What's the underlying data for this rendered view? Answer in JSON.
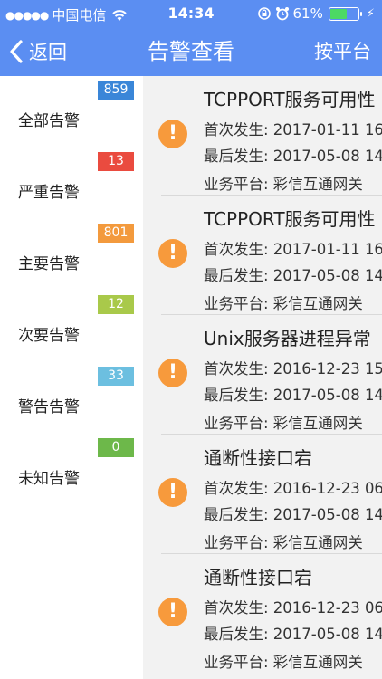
{
  "status_bar": {
    "carrier": "中国电信",
    "time": "14:34",
    "battery_percent": "61%",
    "battery_level": 0.61,
    "battery_color": "#4cd964"
  },
  "nav": {
    "back_label": "返回",
    "title": "告警查看",
    "right_label": "按平台",
    "bar_color": "#5b8ef2"
  },
  "categories": [
    {
      "label": "全部告警",
      "count": "859",
      "color": "#3a86d8"
    },
    {
      "label": "严重告警",
      "count": "13",
      "color": "#ea4b3f"
    },
    {
      "label": "主要告警",
      "count": "801",
      "color": "#f39a3d"
    },
    {
      "label": "次要告警",
      "count": "12",
      "color": "#a9c94a"
    },
    {
      "label": "警告告警",
      "count": "33",
      "color": "#6cbfe0"
    },
    {
      "label": "未知告警",
      "count": "0",
      "color": "#6db84a"
    }
  ],
  "alarms": [
    {
      "title": "TCPPORT服务可用性",
      "first": "首次发生: 2017-01-11 16:",
      "last": "最后发生: 2017-05-08 14:",
      "platform": "业务平台: 彩信互通网关",
      "icon": "exclamation-icon"
    },
    {
      "title": "TCPPORT服务可用性",
      "first": "首次发生: 2017-01-11 16:",
      "last": "最后发生: 2017-05-08 14:",
      "platform": "业务平台: 彩信互通网关",
      "icon": "exclamation-icon"
    },
    {
      "title": "Unix服务器进程异常",
      "first": "首次发生: 2016-12-23 15:",
      "last": "最后发生: 2017-05-08 14:",
      "platform": "业务平台: 彩信互通网关",
      "icon": "exclamation-icon"
    },
    {
      "title": "通断性接口宕",
      "first": "首次发生: 2016-12-23 06:",
      "last": "最后发生: 2017-05-08 14:",
      "platform": "业务平台: 彩信互通网关",
      "icon": "exclamation-icon"
    },
    {
      "title": "通断性接口宕",
      "first": "首次发生: 2016-12-23 06:",
      "last": "最后发生: 2017-05-08 14:",
      "platform": "业务平台: 彩信互通网关",
      "icon": "exclamation-icon"
    }
  ]
}
